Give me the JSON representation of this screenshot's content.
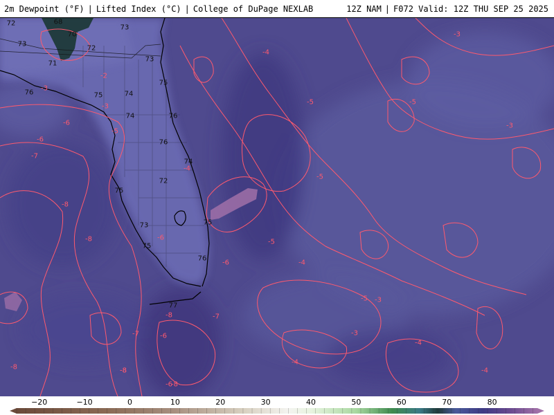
{
  "header": {
    "left": [
      "2m Dewpoint (°F)",
      "Lifted Index (°C)",
      "College of DuPage NEXLAB"
    ],
    "right": [
      "12Z NAM",
      "F072 Valid: 12Z THU SEP 25 2025"
    ],
    "separator": "|"
  },
  "colorbar": {
    "tick_labels": [
      "−20",
      "−10",
      "0",
      "10",
      "20",
      "30",
      "40",
      "50",
      "60",
      "70",
      "80"
    ],
    "tick_values": [
      -20,
      -10,
      0,
      10,
      20,
      30,
      40,
      50,
      60,
      70,
      80
    ],
    "range": [
      -25,
      90
    ],
    "stops": [
      {
        "value": -25,
        "color": "#6b4a3a"
      },
      {
        "value": -5,
        "color": "#8a6a55"
      },
      {
        "value": 10,
        "color": "#a89080"
      },
      {
        "value": 25,
        "color": "#d8d0c0"
      },
      {
        "value": 35,
        "color": "#f4f4f0"
      },
      {
        "value": 40,
        "color": "#e8f4e0"
      },
      {
        "value": 50,
        "color": "#a8d8a0"
      },
      {
        "value": 58,
        "color": "#3e8a4e"
      },
      {
        "value": 64,
        "color": "#3a7a86"
      },
      {
        "value": 68,
        "color": "#1f3a3a"
      },
      {
        "value": 72,
        "color": "#4a5a9a"
      },
      {
        "value": 78,
        "color": "#3e3a84"
      },
      {
        "value": 84,
        "color": "#6a4a90"
      },
      {
        "value": 90,
        "color": "#a070a8"
      }
    ]
  },
  "colors": {
    "ocean_base": "#4f4a8e",
    "land_base": "#6a6ab0",
    "contour": "#ff5a6e",
    "coastline": "#000000"
  },
  "dewpoint_labels": [
    "72",
    "68",
    "73",
    "70",
    "73",
    "72",
    "71",
    "73",
    "75",
    "76",
    "75",
    "74",
    "74",
    "76",
    "76",
    "74",
    "72",
    "75",
    "73",
    "76",
    "75",
    "77",
    "75"
  ],
  "lifted_index_labels": [
    "-3",
    "-4",
    "-3",
    "-2",
    "-3",
    "-5",
    "-5",
    "-6",
    "-6",
    "-5",
    "-3",
    "-7",
    "-6",
    "-5",
    "-4",
    "-3",
    "-8",
    "-8",
    "-6",
    "-5",
    "-4",
    "-8",
    "-6",
    "-7",
    "-3",
    "-8",
    "-8",
    "-7",
    "-5",
    "-4",
    "-4",
    "-8",
    "-8",
    "-6",
    "-4"
  ]
}
